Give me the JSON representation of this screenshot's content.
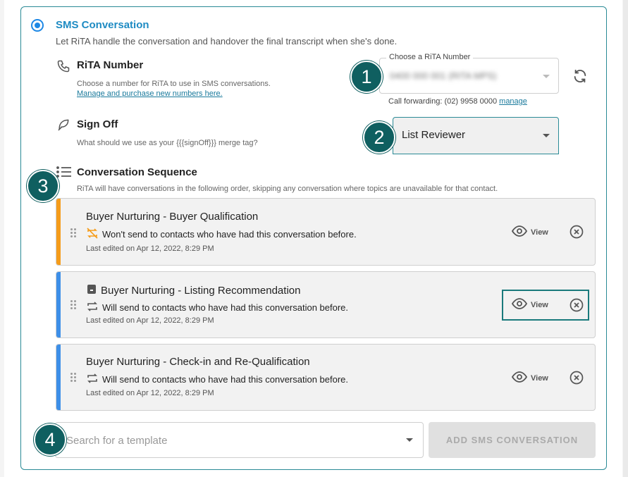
{
  "sms": {
    "title": "SMS Conversation",
    "subtitle": "Let RiTA handle the conversation and handover the final transcript when she's done."
  },
  "rita_number": {
    "title": "RiTA Number",
    "desc": "Choose a number for RiTA to use in SMS conversations.",
    "link": "Manage and purchase new numbers here.",
    "select_label": "Choose a RiTA Number",
    "select_value": "0400 000 001 (RITA MPS)",
    "forwarding_text": "Call forwarding: (02) 9958 0000",
    "forwarding_link": "manage"
  },
  "sign_off": {
    "title": "Sign Off",
    "desc": "What should we use as your {{{signOff}}} merge tag?",
    "value": "List Reviewer"
  },
  "sequence": {
    "title": "Conversation Sequence",
    "desc": "RiTA will have conversations in the following order, skipping any conversation where topics are unavailable for that contact.",
    "items": [
      {
        "title": "Buyer Nurturing - Buyer Qualification",
        "status": "Won't send to contacts who have had this conversation before.",
        "edited": "Last edited on Apr 12, 2022, 8:29 PM",
        "view_label": "View",
        "accent": "#f59c1a"
      },
      {
        "title": "Buyer Nurturing - Listing Recommendation",
        "status": "Will send to contacts who have had this conversation before.",
        "edited": "Last edited on Apr 12, 2022, 8:29 PM",
        "view_label": "View",
        "accent": "#3d8fe8"
      },
      {
        "title": "Buyer Nurturing - Check-in and Re-Qualification",
        "status": "Will send to contacts who have had this conversation before.",
        "edited": "Last edited on Apr 12, 2022, 8:29 PM",
        "view_label": "View",
        "accent": "#3d8fe8"
      }
    ]
  },
  "search": {
    "placeholder": "Search for a template"
  },
  "add_button": "ADD SMS CONVERSATION",
  "badges": [
    "1",
    "2",
    "3",
    "4"
  ],
  "colors": {
    "accent_teal": "#0f5f60",
    "title_blue": "#1e8bc3",
    "warning_orange": "#f59c1a",
    "info_blue": "#3d8fe8"
  }
}
